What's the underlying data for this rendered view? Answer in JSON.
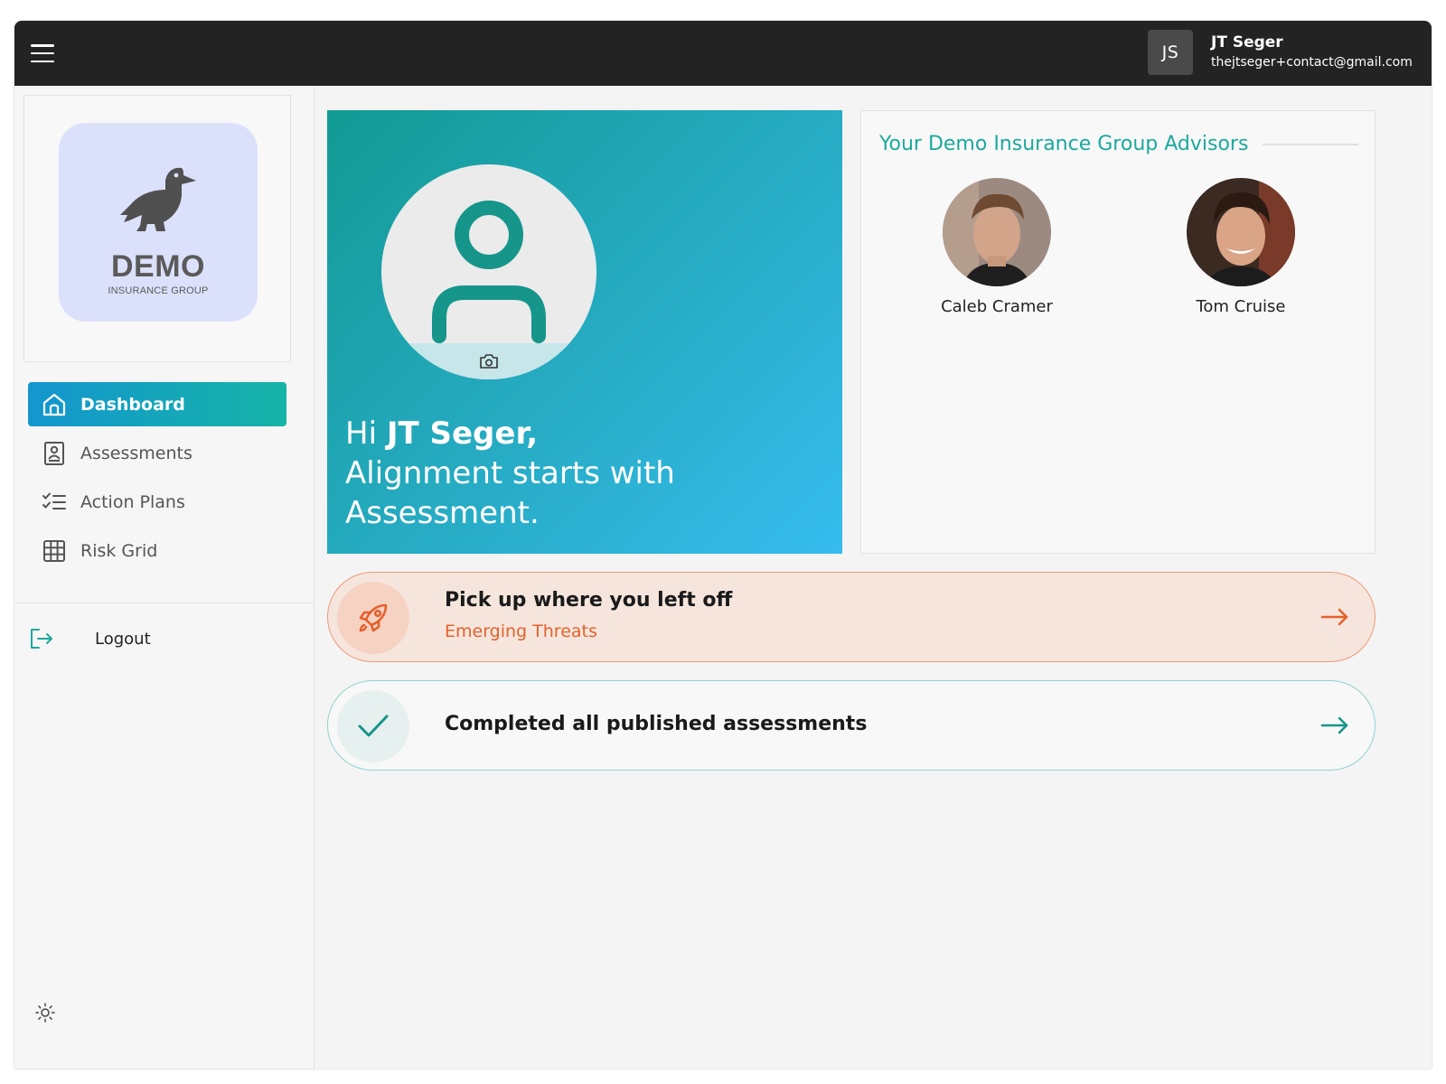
{
  "topbar": {
    "user_initials": "JS",
    "user_name": "JT Seger",
    "user_email": "thejtseger+contact@gmail.com"
  },
  "sidebar": {
    "logo": {
      "word": "DEMO",
      "sub": "INSURANCE GROUP"
    },
    "items": [
      {
        "label": "Dashboard",
        "icon": "home-icon",
        "active": true
      },
      {
        "label": "Assessments",
        "icon": "contact-book-icon"
      },
      {
        "label": "Action Plans",
        "icon": "checklist-icon"
      },
      {
        "label": "Risk Grid",
        "icon": "grid-icon"
      }
    ],
    "logout_label": "Logout"
  },
  "hero": {
    "greeting_prefix": "Hi ",
    "greeting_name": "JT Seger,",
    "line1": "Alignment starts with",
    "line2": "Assessment."
  },
  "advisors": {
    "title": "Your Demo Insurance Group Advisors",
    "people": [
      {
        "name": "Caleb Cramer"
      },
      {
        "name": "Tom Cruise"
      }
    ]
  },
  "cards": {
    "resume": {
      "title": "Pick up where you left off",
      "subtitle": "Emerging Threats",
      "icon": "rocket-icon"
    },
    "completed": {
      "title": "Completed all published assessments",
      "icon": "check-icon"
    }
  },
  "colors": {
    "topbar": "#232323",
    "accent_teal": "#1ba99d",
    "accent_blue": "#1396cf",
    "accent_orange": "#e4612c"
  }
}
